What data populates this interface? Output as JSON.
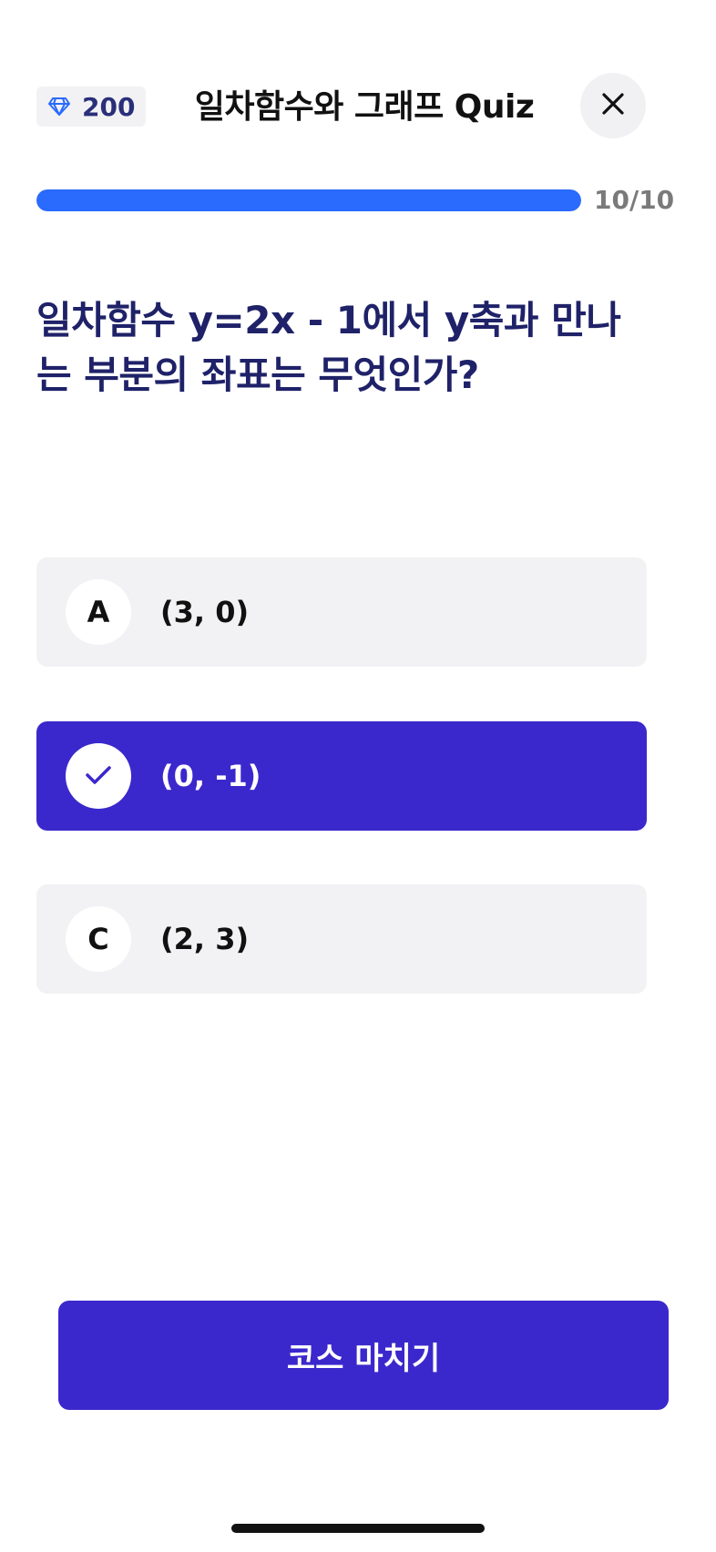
{
  "header": {
    "score": "200",
    "score_icon": "gem-icon",
    "title": "일차함수와 그래프 Quiz",
    "close_icon": "close-icon"
  },
  "progress": {
    "text": "10/10",
    "current": 10,
    "total": 10,
    "fraction": 1.0,
    "color": "#2a6afc"
  },
  "question": {
    "text": "일차함수 y=2x - 1에서 y축과 만나는 부분의 좌표는 무엇인가?"
  },
  "options": [
    {
      "marker": "A",
      "text": "(3, 0)",
      "selected": false
    },
    {
      "marker": "",
      "marker_icon": "check-icon",
      "text": "(0, -1)",
      "selected": true
    },
    {
      "marker": "C",
      "text": "(2, 3)",
      "selected": false
    }
  ],
  "footer": {
    "finish_label": "코스 마치기"
  },
  "colors": {
    "accent": "#3b28cc",
    "progress": "#2a6afc",
    "title_text": "#1f2268",
    "option_bg": "#f2f2f4"
  }
}
